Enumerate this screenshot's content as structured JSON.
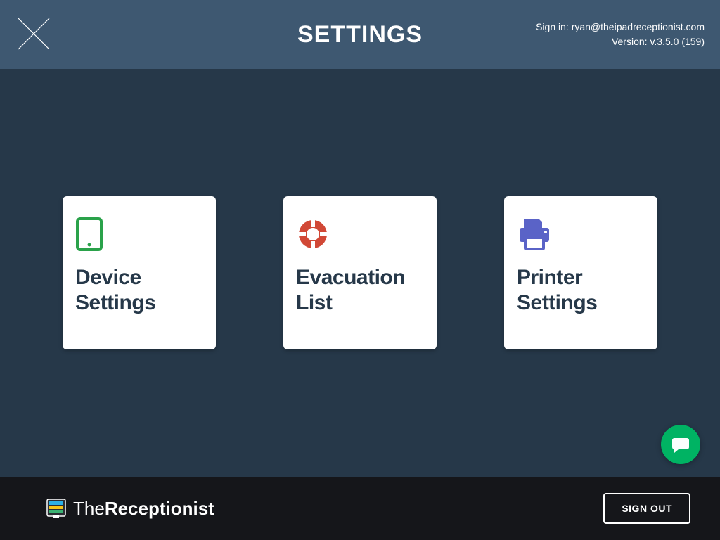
{
  "header": {
    "title": "SETTINGS",
    "signin_label": "Sign in:",
    "signin_email": "ryan@theipadreceptionist.com",
    "version_label": "Version:",
    "version_value": "v.3.5.0 (159)"
  },
  "tiles": {
    "device": "Device Settings",
    "evacuation": "Evacuation List",
    "printer": "Printer Settings"
  },
  "footer": {
    "brand_thin": "The",
    "brand_bold": "Receptionist",
    "signout": "SIGN OUT"
  },
  "colors": {
    "icon_green": "#2aa24a",
    "icon_red": "#d14836",
    "icon_purple": "#5a63c7",
    "fab_green": "#00b363"
  }
}
